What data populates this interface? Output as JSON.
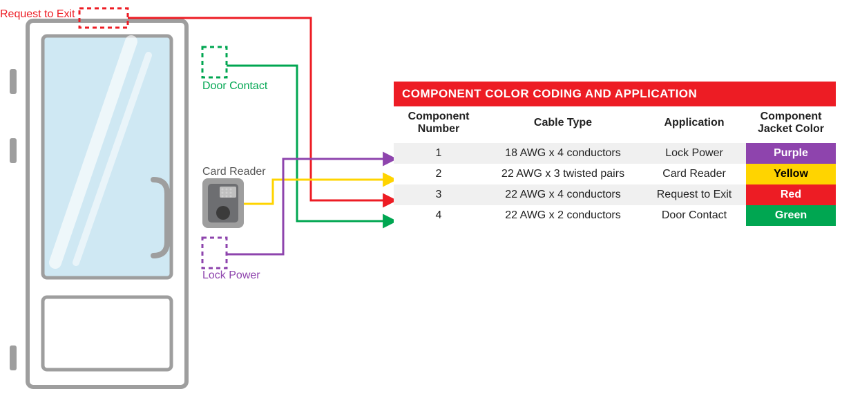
{
  "labels": {
    "request_to_exit": "Request to Exit",
    "door_contact": "Door Contact",
    "card_reader": "Card Reader",
    "lock_power": "Lock Power"
  },
  "colors": {
    "red": "#ED1C24",
    "green": "#00A651",
    "purple": "#8E44AD",
    "yellow": "#FFD400",
    "frame": "#9E9E9E",
    "glass": "#CFE8F3",
    "reader_body": "#6D6E71",
    "reader_face": "#C0C0C0"
  },
  "table": {
    "title": "COMPONENT COLOR CODING AND APPLICATION",
    "headers": {
      "num": "Component\nNumber",
      "cable": "Cable Type",
      "app": "Application",
      "jacket": "Component\nJacket Color"
    },
    "rows": [
      {
        "num": "1",
        "cable": "18 AWG x 4 conductors",
        "app": "Lock Power",
        "jacket_label": "Purple",
        "jacket_class": "purple"
      },
      {
        "num": "2",
        "cable": "22 AWG x 3 twisted pairs",
        "app": "Card Reader",
        "jacket_label": "Yellow",
        "jacket_class": "yellow"
      },
      {
        "num": "3",
        "cable": "22 AWG x 4 conductors",
        "app": "Request to Exit",
        "jacket_label": "Red",
        "jacket_class": "red"
      },
      {
        "num": "4",
        "cable": "22 AWG x 2 conductors",
        "app": "Door Contact",
        "jacket_label": "Green",
        "jacket_class": "green"
      }
    ]
  },
  "chart_data": {
    "type": "table",
    "title": "Component Color Coding and Application",
    "columns": [
      "Component Number",
      "Cable Type",
      "Application",
      "Component Jacket Color"
    ],
    "rows": [
      [
        1,
        "18 AWG x 4 conductors",
        "Lock Power",
        "Purple"
      ],
      [
        2,
        "22 AWG x 3 twisted pairs",
        "Card Reader",
        "Yellow"
      ],
      [
        3,
        "22 AWG x 4 conductors",
        "Request to Exit",
        "Red"
      ],
      [
        4,
        "22 AWG x 2 conductors",
        "Door Contact",
        "Green"
      ]
    ]
  }
}
